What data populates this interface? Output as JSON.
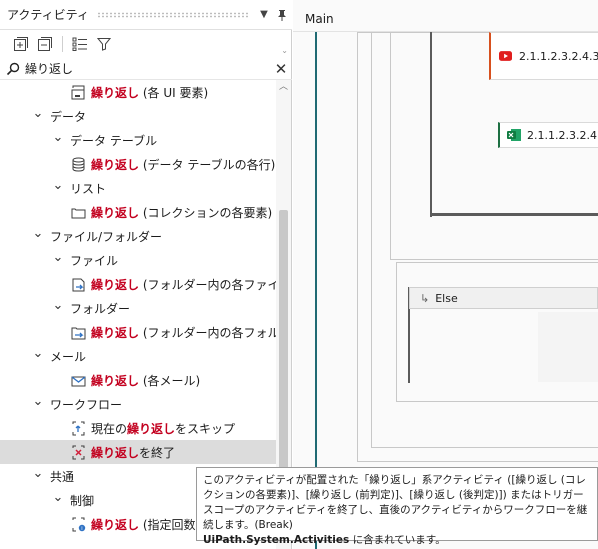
{
  "panel": {
    "title": "アクティビティ"
  },
  "search": {
    "value": "繰り返し",
    "placeholder": ""
  },
  "tree": [
    {
      "depth": 2,
      "chev": "",
      "icon": "for-each-ui-icon",
      "hl": "繰り返し",
      "rest": " (各 UI 要素)",
      "selected": false
    },
    {
      "depth": 0,
      "chev": "down",
      "icon": "",
      "hl": "",
      "rest": "データ",
      "selected": false
    },
    {
      "depth": 1,
      "chev": "down",
      "icon": "",
      "hl": "",
      "rest": "データ テーブル",
      "selected": false
    },
    {
      "depth": 2,
      "chev": "",
      "icon": "datatable-icon",
      "hl": "繰り返し",
      "rest": " (データ テーブルの各行)",
      "selected": false
    },
    {
      "depth": 1,
      "chev": "down",
      "icon": "",
      "hl": "",
      "rest": "リスト",
      "selected": false
    },
    {
      "depth": 2,
      "chev": "",
      "icon": "collection-icon",
      "hl": "繰り返し",
      "rest": " (コレクションの各要素)",
      "selected": false
    },
    {
      "depth": 0,
      "chev": "down",
      "icon": "",
      "hl": "",
      "rest": "ファイル/フォルダー",
      "selected": false
    },
    {
      "depth": 1,
      "chev": "down",
      "icon": "",
      "hl": "",
      "rest": "ファイル",
      "selected": false
    },
    {
      "depth": 2,
      "chev": "",
      "icon": "for-each-file-icon",
      "hl": "繰り返し",
      "rest": " (フォルダー内の各ファイル)",
      "selected": false
    },
    {
      "depth": 1,
      "chev": "down",
      "icon": "",
      "hl": "",
      "rest": "フォルダー",
      "selected": false
    },
    {
      "depth": 2,
      "chev": "",
      "icon": "for-each-folder-icon",
      "hl": "繰り返し",
      "rest": " (フォルダー内の各フォルダー",
      "selected": false
    },
    {
      "depth": 0,
      "chev": "down",
      "icon": "",
      "hl": "",
      "rest": "メール",
      "selected": false
    },
    {
      "depth": 2,
      "chev": "",
      "icon": "for-each-email-icon",
      "hl": "繰り返し",
      "rest": " (各メール)",
      "selected": false
    },
    {
      "depth": 0,
      "chev": "down",
      "icon": "",
      "hl": "",
      "rest": "ワークフロー",
      "selected": false
    },
    {
      "depth": 2,
      "chev": "",
      "icon": "continue-icon",
      "pre": "現在の",
      "hl": "繰り返し",
      "rest": "をスキップ",
      "selected": false
    },
    {
      "depth": 2,
      "chev": "",
      "icon": "break-icon",
      "hl": "繰り返し",
      "rest": "を終了",
      "selected": true
    },
    {
      "depth": 0,
      "chev": "down",
      "icon": "",
      "hl": "",
      "rest": "共通",
      "selected": false
    },
    {
      "depth": 1,
      "chev": "down",
      "icon": "",
      "hl": "",
      "rest": "制御",
      "selected": false
    },
    {
      "depth": 2,
      "chev": "",
      "icon": "repeat-count-icon",
      "hl": "繰り返し",
      "rest": " (指定回数)",
      "selected": false
    }
  ],
  "designer": {
    "tab": "Main",
    "card1_text": "2.1.1.2.3.2.4.3.",
    "card2_text": "2.1.1.2.3.2.4.",
    "else_label": "Else"
  },
  "tooltip": {
    "text": "このアクティビティが配置された「繰り返し」系アクティビティ ([繰り返し (コレクションの各要素)]、[繰り返し (前判定)]、[繰り返し (後判定)]) またはトリガー スコープのアクティビティを終了し、直後のアクティビティからワークフローを継続します。(Break)",
    "package": "UiPath.System.Activities",
    "suffix": " に含まれています。"
  },
  "colors": {
    "accent_teal": "#1f6a73",
    "highlight_red": "#c3001f",
    "youtube_red": "#e01e1e",
    "excel_green": "#1d6f42",
    "card1_border": "#d7501e"
  }
}
